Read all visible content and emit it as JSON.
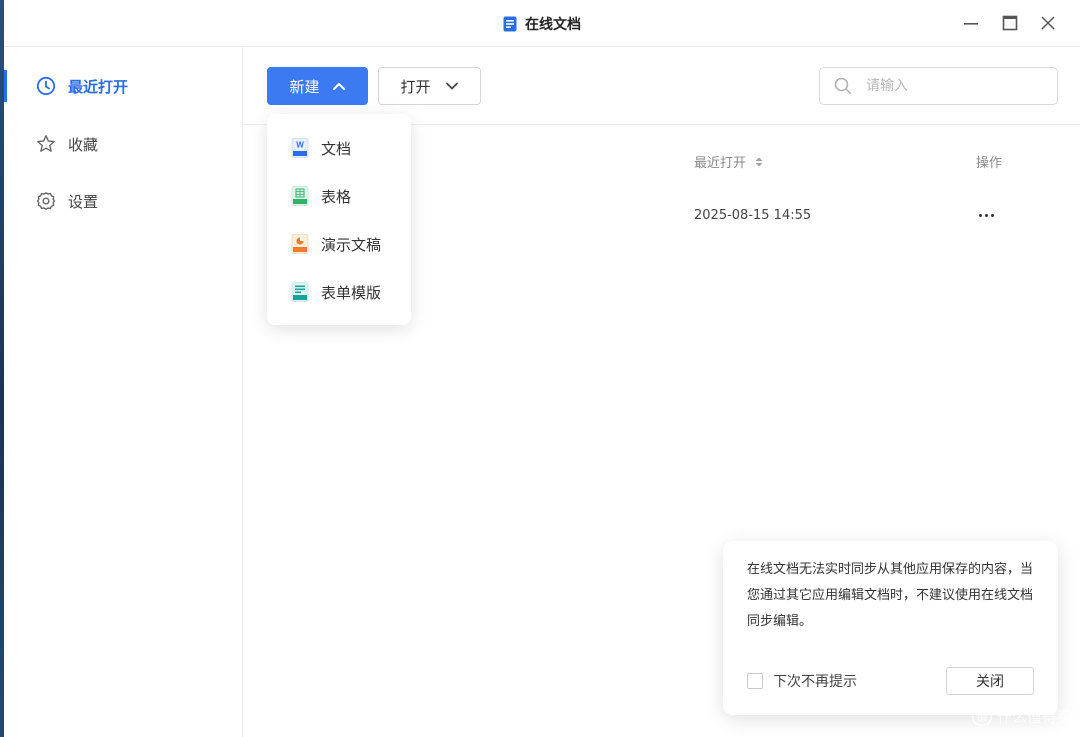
{
  "window": {
    "title": "在线文档"
  },
  "sidebar": {
    "items": [
      {
        "label": "最近打开",
        "icon": "clock-icon",
        "active": true
      },
      {
        "label": "收藏",
        "icon": "star-icon"
      },
      {
        "label": "设置",
        "icon": "gear-icon"
      }
    ]
  },
  "toolbar": {
    "new_label": "新建",
    "open_label": "打开",
    "search_placeholder": "请输入"
  },
  "new_menu": {
    "items": [
      {
        "label": "文档",
        "icon": "word-doc-icon",
        "color": "#3b7af0"
      },
      {
        "label": "表格",
        "icon": "sheet-icon",
        "color": "#2fb36b"
      },
      {
        "label": "演示文稿",
        "icon": "slides-icon",
        "color": "#f07b2a"
      },
      {
        "label": "表单模版",
        "icon": "form-template-icon",
        "color": "#1aa39c"
      }
    ]
  },
  "table": {
    "columns": {
      "last_opened": "最近打开",
      "actions": "操作"
    },
    "rows": [
      {
        "last_opened": "2025-08-15 14:55"
      }
    ]
  },
  "toast": {
    "message": "在线文档无法实时同步从其他应用保存的内容，当您通过其它应用编辑文档时，不建议使用在线文档同步编辑。",
    "dont_show_label": "下次不再提示",
    "close_label": "关闭"
  },
  "watermark": {
    "text": "什么值得买"
  },
  "colors": {
    "accent": "#3b7af0",
    "text": "#333333",
    "muted": "#8a8a8a"
  }
}
